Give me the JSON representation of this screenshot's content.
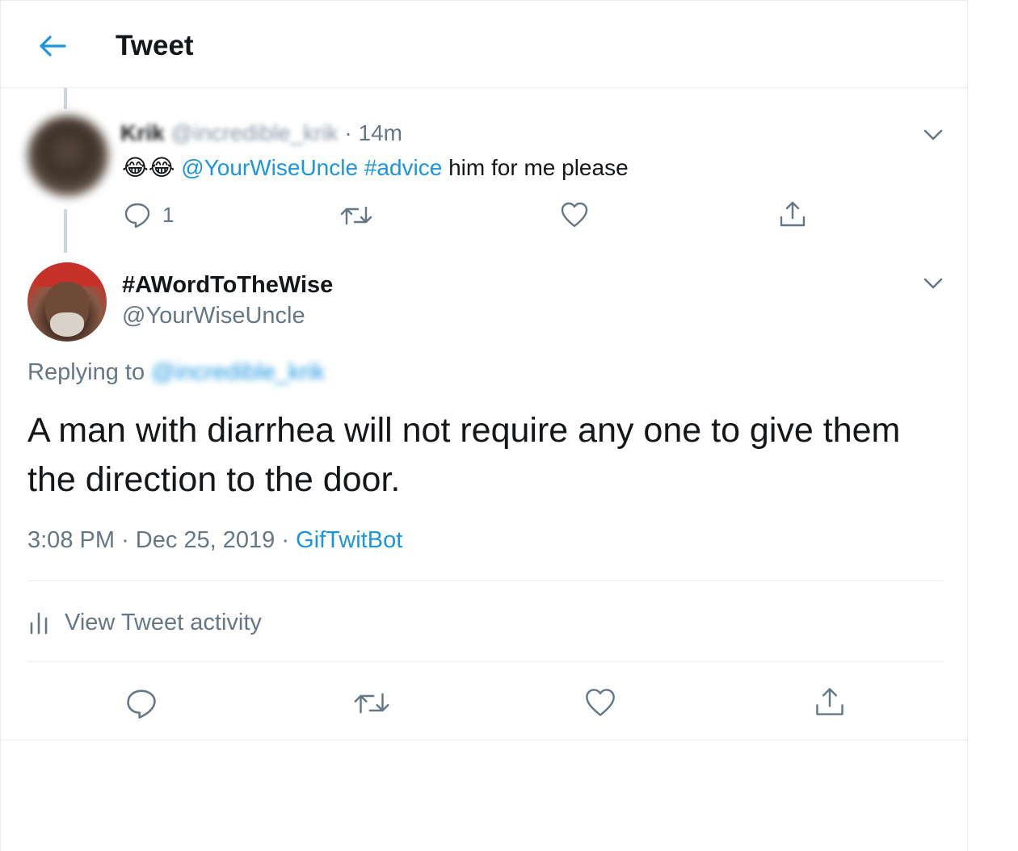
{
  "header": {
    "title": "Tweet"
  },
  "parent_tweet": {
    "display_name": "Krik",
    "handle": "@incredible_krik",
    "separator": "·",
    "time": "14m",
    "emojis": "😂😂",
    "mention": "@YourWiseUncle",
    "hashtag": "#advice",
    "text": "him for me please",
    "reply_count": "1",
    "avatar_icon": "blurred-avatar"
  },
  "main_tweet": {
    "display_name": "#AWordToTheWise",
    "handle": "@YourWiseUncle",
    "replying_label": "Replying to",
    "replying_handle": "@incredible_krik",
    "text": "A man with diarrhea will not require any one to give them the direction to the door.",
    "time": "3:08 PM",
    "date": "Dec 25, 2019",
    "separator": "·",
    "source": "GifTwitBot",
    "activity_label": "View Tweet activity"
  },
  "colors": {
    "accent": "#1b95e0",
    "secondary_text": "#657786",
    "primary_text": "#14171a",
    "border": "#e6ecf0",
    "thread_line": "#ccd6dd"
  },
  "icons": {
    "back": "arrow-left-icon",
    "reply": "speech-bubble-icon",
    "retweet": "retweet-icon",
    "like": "heart-icon",
    "share": "share-upload-icon",
    "more": "chevron-down-icon",
    "activity": "bar-chart-icon"
  }
}
